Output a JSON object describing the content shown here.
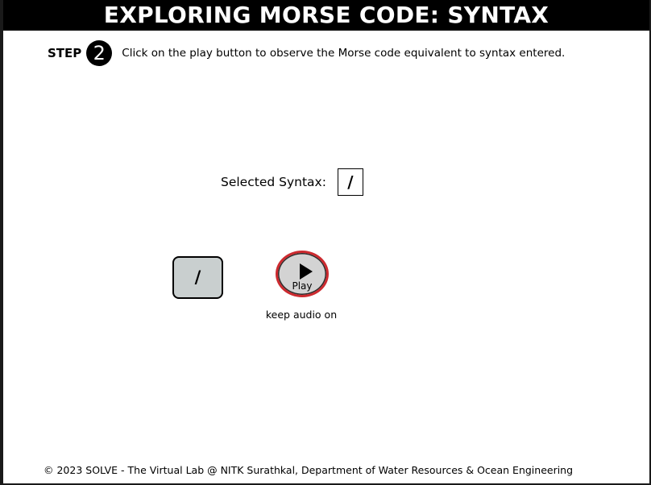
{
  "header": {
    "title": "EXPLORING MORSE CODE: SYNTAX"
  },
  "step": {
    "label": "STEP",
    "number": "2",
    "instruction": "Click on the play button to observe the Morse code equivalent to syntax entered."
  },
  "syntax": {
    "label": "Selected Syntax:",
    "value": "/"
  },
  "controls": {
    "key_label": "/",
    "play_label": "Play",
    "audio_note": "keep audio on"
  },
  "footer": {
    "text": "© 2023 SOLVE - The Virtual Lab @ NITK Surathkal, Department of Water Resources & Ocean Engineering"
  },
  "colors": {
    "title_bar": "#000000",
    "key_button_fill": "#c9cfcf",
    "play_button_fill": "#d3d3d3",
    "play_button_ring": "#cc2a2f"
  },
  "icons": {
    "play": "play-triangle-icon"
  }
}
